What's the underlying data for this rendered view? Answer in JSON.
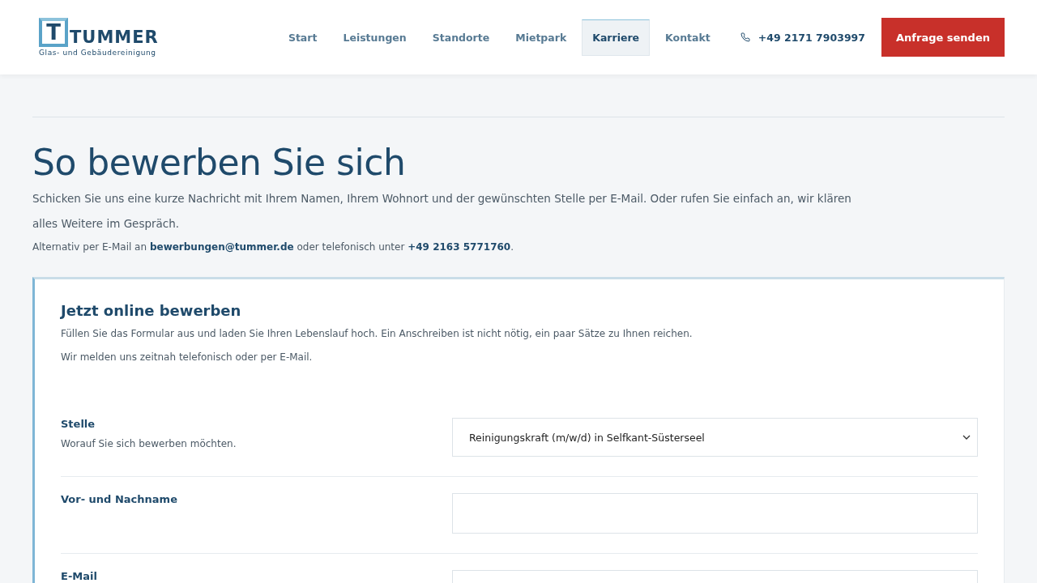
{
  "logo": {
    "letter": "T",
    "name": "TUMMER",
    "tagline": "Glas- und Gebäudereinigung"
  },
  "nav": [
    {
      "label": "Start",
      "selected": false
    },
    {
      "label": "Leistungen",
      "selected": false
    },
    {
      "label": "Standorte",
      "selected": false
    },
    {
      "label": "Mietpark",
      "selected": false
    },
    {
      "label": "Karriere",
      "selected": true
    },
    {
      "label": "Kontakt",
      "selected": false
    }
  ],
  "phone": "+49 2171 7903997",
  "cta": "Anfrage senden",
  "heading": "So bewerben Sie sich",
  "intro": "Schicken Sie uns eine kurze Nachricht mit Ihrem Namen, Ihrem Wohnort und der gewünschten Stelle per E-Mail. Oder rufen Sie einfach an, wir klären alles Weitere im Gespräch.",
  "alt": {
    "before": "Alternativ per E-Mail an",
    "email": "bewerbungen@tummer.de",
    "middle": "oder telefonisch unter",
    "phone": "+49 2163 5771760",
    "after": "."
  },
  "form": {
    "title": "Jetzt online bewerben",
    "description": "Füllen Sie das Formular aus und laden Sie Ihren Lebenslauf hoch. Ein Anschreiben ist nicht nötig, ein paar Sätze zu Ihnen reichen. Wir melden uns zeitnah telefonisch oder per E-Mail.",
    "fields": [
      {
        "kind": "select",
        "label": "Stelle",
        "hint": "Worauf Sie sich bewerben möchten.",
        "value": "Reinigungskraft (m/w/d) in Selfkant-Süsterseel"
      },
      {
        "kind": "text",
        "label": "Vor- und Nachname"
      },
      {
        "kind": "text",
        "label": "E-Mail"
      }
    ]
  }
}
